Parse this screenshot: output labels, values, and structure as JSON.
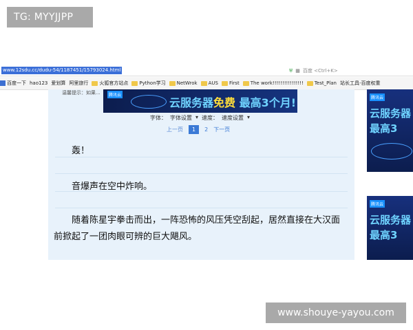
{
  "badge": "TG: MYYJJPP",
  "browser": {
    "url": "www.12sdu.cc/dudu-54/1187451/15793024.html",
    "search_placeholder": "百度 <Ctrl+K>",
    "bookmarks": [
      "百度一下",
      "hao123",
      "爱划算",
      "阿里旅行",
      "火狐官方站点",
      "Python学习",
      "NetWrok",
      "AUS",
      "First",
      "The work!!!!!!!!!!!!!!!!",
      "Test_Plan",
      "站长工具-百度权重"
    ]
  },
  "page": {
    "notice": "温馨提示：如果...",
    "banner": {
      "logo": "腾讯云",
      "text_a": "云服务器",
      "text_free": "免费",
      "text_b": "最高3个月!"
    },
    "settings": {
      "font_label": "字体：",
      "font_select": "字体设置",
      "speed_label": "速度：",
      "speed_select": "速度设置"
    },
    "pager": {
      "prev": "上一页",
      "p1": "1",
      "p2": "2",
      "next": "下一页"
    },
    "paragraphs": [
      "轰！",
      "音爆声在空中炸响。",
      "随着陈星宇拳击而出，一阵恐怖的风压凭空刮起，居然直接在大汉面",
      "前掀起了一团肉眼可辨的巨大飓风。"
    ]
  },
  "side_ad": {
    "logo": "腾讯云",
    "line1": "云服务器",
    "line2": "最高3"
  },
  "watermark": "www.shouye-yayou.com"
}
